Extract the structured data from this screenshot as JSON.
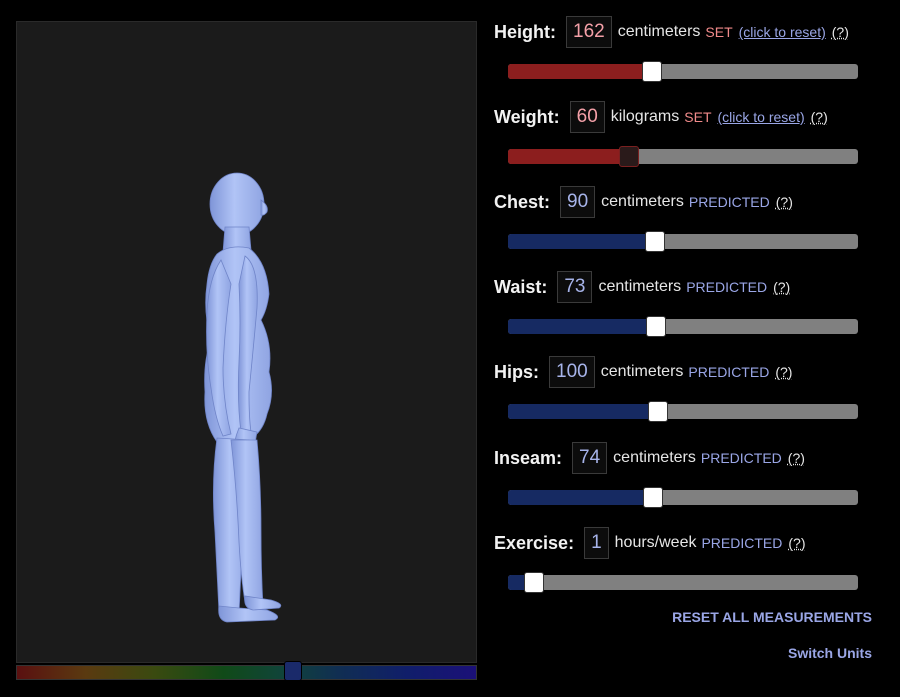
{
  "measurements": [
    {
      "key": "height",
      "label": "Height:",
      "value": "162",
      "unit": "centimeters",
      "status": "SET",
      "status_kind": "set",
      "reset_link": "(click to reset)",
      "help": "(?)",
      "fraction": 0.406,
      "track": "red",
      "thumb_style": "light"
    },
    {
      "key": "weight",
      "label": "Weight:",
      "value": "60",
      "unit": "kilograms",
      "status": "SET",
      "status_kind": "set",
      "reset_link": "(click to reset)",
      "help": "(?)",
      "fraction": 0.34,
      "track": "red",
      "thumb_style": "dark"
    },
    {
      "key": "chest",
      "label": "Chest:",
      "value": "90",
      "unit": "centimeters",
      "status": "PREDICTED",
      "status_kind": "pred",
      "help": "(?)",
      "fraction": 0.414,
      "track": "blue",
      "thumb_style": "light"
    },
    {
      "key": "waist",
      "label": "Waist:",
      "value": "73",
      "unit": "centimeters",
      "status": "PREDICTED",
      "status_kind": "pred",
      "help": "(?)",
      "fraction": 0.417,
      "track": "blue",
      "thumb_style": "light"
    },
    {
      "key": "hips",
      "label": "Hips:",
      "value": "100",
      "unit": "centimeters",
      "status": "PREDICTED",
      "status_kind": "pred",
      "help": "(?)",
      "fraction": 0.423,
      "track": "blue",
      "thumb_style": "light"
    },
    {
      "key": "inseam",
      "label": "Inseam:",
      "value": "74",
      "unit": "centimeters",
      "status": "PREDICTED",
      "status_kind": "pred",
      "help": "(?)",
      "fraction": 0.409,
      "track": "blue",
      "thumb_style": "light"
    },
    {
      "key": "exercise",
      "label": "Exercise:",
      "value": "1",
      "unit": "hours/week",
      "status": "PREDICTED",
      "status_kind": "pred",
      "help": "(?)",
      "fraction": 0.069,
      "track": "blue",
      "thumb_style": "light"
    }
  ],
  "actions": {
    "reset_all": "RESET ALL MEASUREMENTS",
    "switch_units": "Switch Units"
  },
  "viewer": {
    "body_color": "#a9bdf2",
    "background": "#1b1b1b",
    "hue_position": 0.6
  }
}
